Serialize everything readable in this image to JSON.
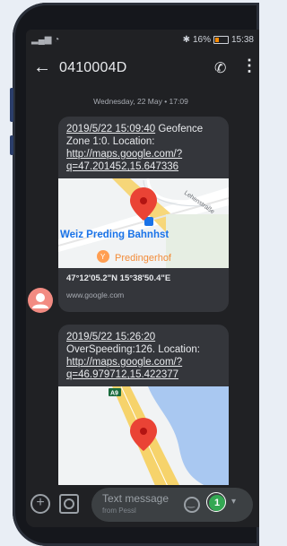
{
  "status": {
    "signal_icons": "▂▄▆ ◔",
    "bluetooth": "✱",
    "battery_pct": "16%",
    "time": "15:38"
  },
  "header": {
    "title": "0410004D"
  },
  "thread": {
    "date": "Wednesday, 22 May • 17:09"
  },
  "messages": [
    {
      "timestamp": "2019/5/22 15:09:40",
      "text": " Geofence Zone 1:0. Location: ",
      "link": "http://maps.google.com/?q=47.201452,15.647336",
      "map_labels": {
        "street": "Lehenstraße",
        "station": "Weiz Preding Bahnhst",
        "poi": "Predingerhof"
      },
      "preview_title": "47°12'05.2\"N 15°38'50.4\"E",
      "preview_domain": "www.google.com"
    },
    {
      "timestamp": "2019/5/22 15:26:20",
      "text": " OverSpeeding:126. Location: ",
      "link": "http://maps.google.com/?q=46.979712,15.422377",
      "map_labels": {
        "road": "A9"
      }
    }
  ],
  "composer": {
    "placeholder": "Text message",
    "subtext": "from Pessl",
    "sim_number": "1"
  }
}
